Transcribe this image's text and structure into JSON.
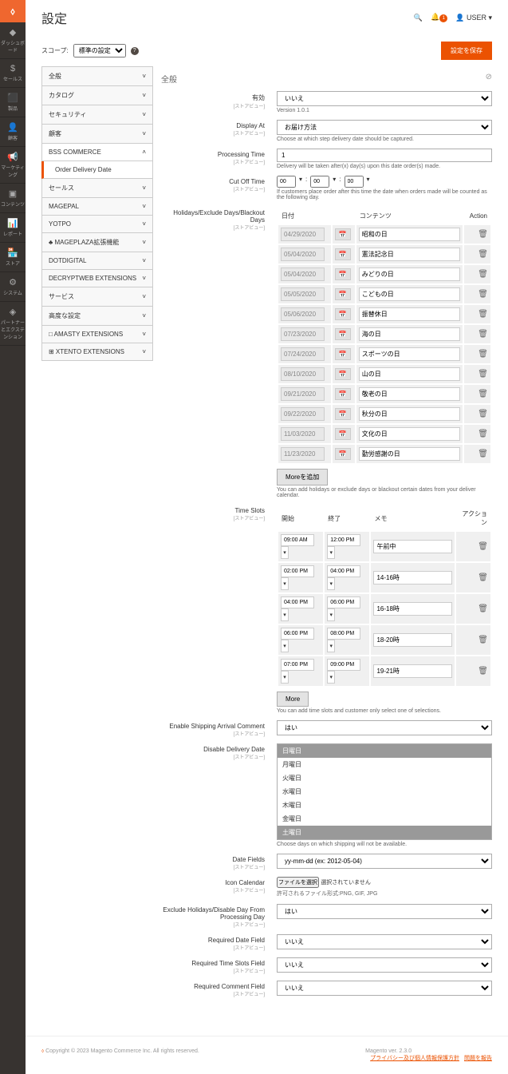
{
  "header": {
    "title": "設定",
    "user": "USER",
    "notif_count": "1"
  },
  "toolbar": {
    "scope_label": "スコープ:",
    "scope_value": "標準の設定",
    "save": "設定を保存"
  },
  "nav": {
    "items": [
      {
        "label": "全般",
        "exp": false
      },
      {
        "label": "カタログ",
        "exp": false
      },
      {
        "label": "セキュリティ",
        "exp": false
      },
      {
        "label": "顧客",
        "exp": false
      },
      {
        "label": "BSS COMMERCE",
        "exp": true,
        "sub": "Order Delivery Date"
      },
      {
        "label": "セールス",
        "exp": false
      },
      {
        "label": "MAGEPAL",
        "exp": false
      },
      {
        "label": "YOTPO",
        "exp": false
      },
      {
        "label": "♣ MAGEPLAZA拡張機能",
        "exp": false
      },
      {
        "label": "DOTDIGITAL",
        "exp": false
      },
      {
        "label": "DECRYPTWEB EXTENSIONS",
        "exp": false
      },
      {
        "label": "サービス",
        "exp": false
      },
      {
        "label": "高度な設定",
        "exp": false
      },
      {
        "label": "□ AMASTY EXTENSIONS",
        "exp": false
      },
      {
        "label": "⊞ XTENTO EXTENSIONS",
        "exp": false
      }
    ]
  },
  "sidebar": [
    {
      "icon": "◆",
      "label": "ダッシュボード"
    },
    {
      "icon": "$",
      "label": "セールス"
    },
    {
      "icon": "⬛",
      "label": "製品"
    },
    {
      "icon": "👤",
      "label": "顧客"
    },
    {
      "icon": "📢",
      "label": "マーケティング"
    },
    {
      "icon": "▣",
      "label": "コンテンツ"
    },
    {
      "icon": "📊",
      "label": "レポート"
    },
    {
      "icon": "🏪",
      "label": "ストア"
    },
    {
      "icon": "⚙",
      "label": "システム"
    },
    {
      "icon": "◈",
      "label": "パートナーとエクステンション"
    }
  ],
  "section": {
    "title": "全般"
  },
  "fields": {
    "enabled": {
      "label": "有効",
      "sub": "[ストアビュー]",
      "value": "いいえ",
      "note": "Version 1.0.1"
    },
    "display_at": {
      "label": "Display At",
      "sub": "[ストアビュー]",
      "value": "お届け方法",
      "note": "Choose at which step delivery date should be captured."
    },
    "processing": {
      "label": "Processing Time",
      "sub": "[ストアビュー]",
      "value": "1",
      "note": "Delivery will be taken after(x) day(s) upon this date order(s) made."
    },
    "cutoff": {
      "label": "Cut Off Time",
      "sub": "[ストアビュー]",
      "h": "00",
      "m": "00",
      "s": "00",
      "note": "If customers place order after this time the date when orders made will be counted as the following day."
    },
    "holidays": {
      "label": "Holidays/Exclude Days/Blackout Days",
      "sub": "[ストアビュー]",
      "col_date": "日付",
      "col_content": "コンテンツ",
      "col_action": "Action",
      "note": "You can add holidays or exclude days or blackout certain dates from your deliver calendar.",
      "more": "Moreを追加",
      "rows": [
        {
          "date": "04/29/2020",
          "content": "昭和の日"
        },
        {
          "date": "05/04/2020",
          "content": "憲法記念日"
        },
        {
          "date": "05/04/2020",
          "content": "みどりの日"
        },
        {
          "date": "05/05/2020",
          "content": "こどもの日"
        },
        {
          "date": "05/06/2020",
          "content": "振替休日"
        },
        {
          "date": "07/23/2020",
          "content": "海の日"
        },
        {
          "date": "07/24/2020",
          "content": "スポーツの日"
        },
        {
          "date": "08/10/2020",
          "content": "山の日"
        },
        {
          "date": "09/21/2020",
          "content": "敬老の日"
        },
        {
          "date": "09/22/2020",
          "content": "秋分の日"
        },
        {
          "date": "11/03/2020",
          "content": "文化の日"
        },
        {
          "date": "11/23/2020",
          "content": "勤労感謝の日"
        }
      ]
    },
    "timeslots": {
      "label": "Time Slots",
      "sub": "[ストアビュー]",
      "col_start": "開始",
      "col_end": "終了",
      "col_note": "メモ",
      "col_action": "アクション",
      "more": "More",
      "note": "You can add time slots and customer only select one of selections.",
      "rows": [
        {
          "start": "09:00 AM",
          "end": "12:00 PM",
          "note": "午前中"
        },
        {
          "start": "02:00 PM",
          "end": "04:00 PM",
          "note": "14-16時"
        },
        {
          "start": "04:00 PM",
          "end": "06:00 PM",
          "note": "16-18時"
        },
        {
          "start": "06:00 PM",
          "end": "08:00 PM",
          "note": "18-20時"
        },
        {
          "start": "07:00 PM",
          "end": "09:00 PM",
          "note": "19-21時"
        }
      ]
    },
    "shipping_comment": {
      "label": "Enable Shipping Arrival Comment",
      "sub": "[ストアビュー]",
      "value": "はい"
    },
    "disable_days": {
      "label": "Disable Delivery Date",
      "sub": "[ストアビュー]",
      "note": "Choose days on which shipping will not be available.",
      "days": [
        {
          "l": "日曜日",
          "s": true
        },
        {
          "l": "月曜日",
          "s": false
        },
        {
          "l": "火曜日",
          "s": false
        },
        {
          "l": "水曜日",
          "s": false
        },
        {
          "l": "木曜日",
          "s": false
        },
        {
          "l": "金曜日",
          "s": false
        },
        {
          "l": "土曜日",
          "s": true
        }
      ]
    },
    "date_fields": {
      "label": "Date Fields",
      "sub": "[ストアビュー]",
      "value": "yy-mm-dd (ex: 2012-05-04)"
    },
    "icon_cal": {
      "label": "Icon Calendar",
      "sub": "[ストアビュー]",
      "btn": "ファイルを選択",
      "chosen": "選択されていません",
      "note": "許可されるファイル形式:PNG, GIF, JPG"
    },
    "exclude_proc": {
      "label": "Exclude Holidays/Disable Day From Processing Day",
      "sub": "[ストアビュー]",
      "value": "はい"
    },
    "req_date": {
      "label": "Required Date Field",
      "sub": "[ストアビュー]",
      "value": "いいえ"
    },
    "req_slots": {
      "label": "Required Time Slots Field",
      "sub": "[ストアビュー]",
      "value": "いいえ"
    },
    "req_comment": {
      "label": "Required Comment Field",
      "sub": "[ストアビュー]",
      "value": "いいえ"
    }
  },
  "footer": {
    "copy": "Copyright © 2023 Magento Commerce Inc. All rights reserved.",
    "ver": "Magento ver. 2.3.0",
    "links": [
      "プライバシー及び個人情報保護方針",
      "問題を報告"
    ]
  }
}
